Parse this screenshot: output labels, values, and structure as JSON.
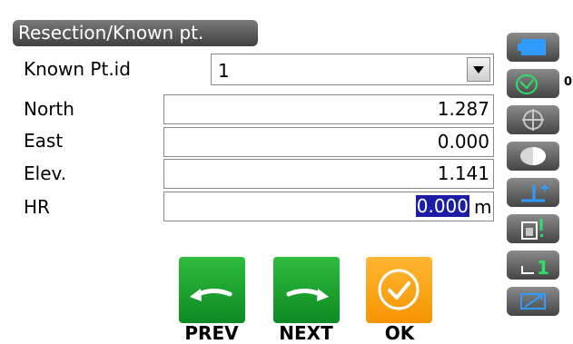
{
  "title": "Resection/Known pt.",
  "known_pt": {
    "label": "Known Pt.id",
    "value": "1"
  },
  "fields": [
    {
      "label": "North",
      "value": "1.287"
    },
    {
      "label": "East",
      "value": "0.000"
    },
    {
      "label": "Elev.",
      "value": "1.141"
    },
    {
      "label": "HR",
      "value": "0.000",
      "unit": "m"
    }
  ],
  "buttons": {
    "prev": "PREV",
    "next": "NEXT",
    "ok": "OK"
  },
  "side_panel": {
    "tilt_count": "0",
    "target_number": "1",
    "icons": [
      "battery-icon",
      "tilt-icon",
      "target-icon",
      "prism-icon",
      "height-plus-icon",
      "memory-icon",
      "target-height-icon",
      "keyboard-icon"
    ]
  },
  "colors": {
    "accent_green": "#1aa030",
    "accent_orange": "#f8a31a",
    "selection": "#1c1ca6"
  }
}
